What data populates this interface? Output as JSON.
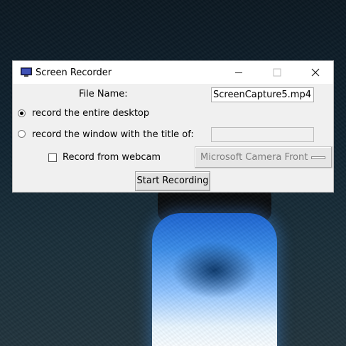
{
  "window": {
    "title": "Screen Recorder",
    "icon": "monitor-icon"
  },
  "titlebar_buttons": {
    "minimize_icon": "minimize-icon",
    "maximize_icon": "maximize-icon",
    "close_icon": "close-icon"
  },
  "form": {
    "file_name_label": "File Name:",
    "file_name_value": "ScreenCapture5.mp4",
    "radio_desktop_label": "record the entire desktop",
    "radio_desktop_selected": true,
    "radio_window_label": "record the window with the title of:",
    "radio_window_selected": false,
    "window_title_value": "",
    "webcam_label": "Record from webcam",
    "webcam_checked": false,
    "camera_selected": "Microsoft Camera Front",
    "start_button_label": "Start Recording"
  }
}
